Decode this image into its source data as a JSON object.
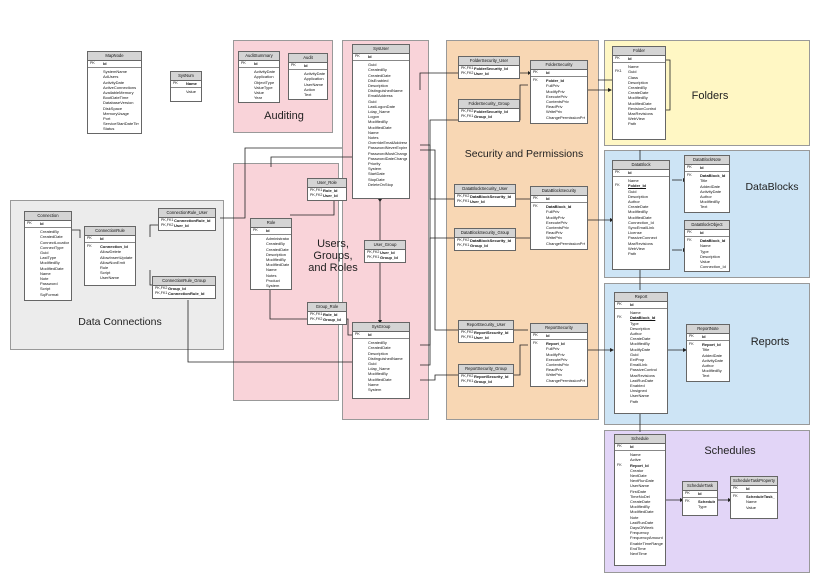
{
  "colors": {
    "auditing": "#f9d3d9",
    "users": "#f9d3d9",
    "security": "#f8d7b4",
    "folders": "#fff7c4",
    "datablocks": "#cde4f5",
    "reports": "#cde4f5",
    "schedules": "#e2d5f7",
    "connections": "#ececec"
  },
  "regions": {
    "auditing": "Auditing",
    "users": "Users,\nGroups,\nand Roles",
    "security": "Security and Permissions",
    "folders": "Folders",
    "datablocks": "DataBlocks",
    "reports": "Reports",
    "schedules": "Schedules",
    "connections": "Data Connections"
  },
  "tables": {
    "mapnode": {
      "name": "MapNode",
      "rows": [
        {
          "k": "PK",
          "f": "Id",
          "b": true
        },
        {
          "sep": true
        },
        {
          "f": "SystemName"
        },
        {
          "f": "AdUsers"
        },
        {
          "f": "ActivityDate"
        },
        {
          "f": "ActiveConnections"
        },
        {
          "f": "AvailableMemory"
        },
        {
          "f": "BootDateTime"
        },
        {
          "f": "DatabaseVersion"
        },
        {
          "f": "DiskSpace"
        },
        {
          "f": "MemoryUsage"
        },
        {
          "f": "Port"
        },
        {
          "f": "ServiceStartDateTime"
        },
        {
          "f": "Status"
        }
      ]
    },
    "sysnum": {
      "name": "SysNum",
      "rows": [
        {
          "k": "PK",
          "f": "Name",
          "b": true
        },
        {
          "sep": true
        },
        {
          "f": "Value"
        }
      ]
    },
    "auditsummary": {
      "name": "AuditSummary",
      "rows": [
        {
          "k": "PK",
          "f": "Id",
          "b": true
        },
        {
          "sep": true
        },
        {
          "f": "ActivityDate"
        },
        {
          "f": "Application"
        },
        {
          "f": "ObjectType"
        },
        {
          "f": "ValueType"
        },
        {
          "f": "Value"
        },
        {
          "f": "Year"
        }
      ]
    },
    "audit": {
      "name": "Audit",
      "rows": [
        {
          "k": "PK",
          "f": "Id",
          "b": true
        },
        {
          "sep": true
        },
        {
          "f": "ActivityDate"
        },
        {
          "f": "Application"
        },
        {
          "f": "UserName"
        },
        {
          "f": "Action"
        },
        {
          "f": "Text"
        }
      ]
    },
    "sysuser": {
      "name": "SysUser",
      "rows": [
        {
          "k": "PK",
          "f": "Id",
          "b": true
        },
        {
          "sep": true
        },
        {
          "f": "Guid"
        },
        {
          "f": "CreatedBy"
        },
        {
          "f": "CreatedDate"
        },
        {
          "f": "DisEnabled"
        },
        {
          "f": "Description"
        },
        {
          "f": "DistinguishedName"
        },
        {
          "f": "EmailAddress"
        },
        {
          "f": "Guid"
        },
        {
          "f": "LastLogonDate"
        },
        {
          "f": "Ldap_Name"
        },
        {
          "f": "Logon"
        },
        {
          "f": "ModifiedBy"
        },
        {
          "f": "ModifiedDate"
        },
        {
          "f": "Name"
        },
        {
          "f": "Notes"
        },
        {
          "f": "OverrideEmailAddress"
        },
        {
          "f": "PasswordNeverExpire"
        },
        {
          "f": "PasswordMustChange"
        },
        {
          "f": "PasswordDateChanged"
        },
        {
          "f": "Priority"
        },
        {
          "f": "System"
        },
        {
          "f": "StartDate"
        },
        {
          "f": "StopDate"
        },
        {
          "f": "DeleteOnStop"
        }
      ]
    },
    "user_role": {
      "name": "User_Role",
      "rows": [
        {
          "k": "PK,FK1",
          "f": "Role_Id",
          "b": true
        },
        {
          "k": "PK,FK2",
          "f": "User_Id",
          "b": true
        }
      ]
    },
    "role": {
      "name": "Role",
      "rows": [
        {
          "k": "PK",
          "f": "Id",
          "b": true
        },
        {
          "sep": true
        },
        {
          "f": "Administrator"
        },
        {
          "f": "CreatedBy"
        },
        {
          "f": "CreatedDate"
        },
        {
          "f": "Description"
        },
        {
          "f": "ModifiedBy"
        },
        {
          "f": "ModifiedDate"
        },
        {
          "f": "Name"
        },
        {
          "f": "Notes"
        },
        {
          "f": "Product"
        },
        {
          "f": "System"
        }
      ]
    },
    "user_group": {
      "name": "User_Group",
      "rows": [
        {
          "k": "PK,FK2",
          "f": "User_Id",
          "b": true
        },
        {
          "k": "PK,FK1",
          "f": "Group_Id",
          "b": true
        }
      ]
    },
    "group_role": {
      "name": "Group_Role",
      "rows": [
        {
          "k": "PK,FK1",
          "f": "Role_Id",
          "b": true
        },
        {
          "k": "PK,FK2",
          "f": "Group_Id",
          "b": true
        }
      ]
    },
    "sysgroup": {
      "name": "SysGroup",
      "rows": [
        {
          "k": "PK",
          "f": "Id",
          "b": true
        },
        {
          "sep": true
        },
        {
          "f": "CreatedBy"
        },
        {
          "f": "CreatedDate"
        },
        {
          "f": "Description"
        },
        {
          "f": "DistinguishedName"
        },
        {
          "f": "Guid"
        },
        {
          "f": "Ldap_Name"
        },
        {
          "f": "ModifiedBy"
        },
        {
          "f": "ModifiedDate"
        },
        {
          "f": "Name"
        },
        {
          "f": "System"
        }
      ]
    },
    "connectionrule_user": {
      "name": "ConnectionRule_User",
      "rows": [
        {
          "k": "PK,FK1",
          "f": "ConnectionRule_Id",
          "b": true
        },
        {
          "k": "PK,FK2",
          "f": "User_Id",
          "b": true
        }
      ]
    },
    "connection": {
      "name": "Connection",
      "rows": [
        {
          "k": "PK",
          "f": "Id",
          "b": true
        },
        {
          "sep": true
        },
        {
          "f": "CreatedBy"
        },
        {
          "f": "CreatedDate"
        },
        {
          "f": "ConnectLocation"
        },
        {
          "f": "ConnectType"
        },
        {
          "f": "Guid"
        },
        {
          "f": "LastType"
        },
        {
          "f": "ModifiedBy"
        },
        {
          "f": "ModifiedDate"
        },
        {
          "f": "Name"
        },
        {
          "f": "Note"
        },
        {
          "f": "Password"
        },
        {
          "f": "Script"
        },
        {
          "f": "SqlFormat"
        }
      ]
    },
    "connectionrule": {
      "name": "ConnectionRule",
      "rows": [
        {
          "k": "PK",
          "f": "Id",
          "b": true
        },
        {
          "sep": true
        },
        {
          "k": "FK",
          "f": "Connection_Id",
          "b": true
        },
        {
          "f": "AllowDelete"
        },
        {
          "f": "AllowInsertUpdate"
        },
        {
          "f": "AllowNonEmit"
        },
        {
          "f": "Rule"
        },
        {
          "f": "Script"
        },
        {
          "f": "UserName"
        }
      ]
    },
    "connectionrule_group": {
      "name": "ConnectionRule_Group",
      "rows": [
        {
          "k": "PK,FK2",
          "f": "Group_Id",
          "b": true
        },
        {
          "k": "PK,FK1",
          "f": "ConnectionRule_Id",
          "b": true
        }
      ]
    },
    "foldersecurity_user": {
      "name": "FolderSecurity_User",
      "rows": [
        {
          "k": "PK,FK1",
          "f": "FolderSecurity_Id",
          "b": true
        },
        {
          "k": "PK,FK2",
          "f": "User_Id",
          "b": true
        }
      ]
    },
    "foldersecurity_group": {
      "name": "FolderSecurity_Group",
      "rows": [
        {
          "k": "PK,FK2",
          "f": "FolderSecurity_Id",
          "b": true
        },
        {
          "k": "PK,FK1",
          "f": "Group_Id",
          "b": true
        }
      ]
    },
    "foldersecurity": {
      "name": "FolderSecurity",
      "rows": [
        {
          "k": "PK",
          "f": "Id",
          "b": true
        },
        {
          "sep": true
        },
        {
          "k": "FK",
          "f": "Folder_Id",
          "b": true
        },
        {
          "f": "FullPriv"
        },
        {
          "f": "ModifyPriv"
        },
        {
          "f": "ExecutePriv"
        },
        {
          "f": "ContentsPriv"
        },
        {
          "f": "ReadPriv"
        },
        {
          "f": "WritePriv"
        },
        {
          "f": "ChangePermissionPriv"
        }
      ]
    },
    "folder": {
      "name": "Folder",
      "rows": [
        {
          "k": "PK",
          "f": "Id",
          "b": true
        },
        {
          "sep": true
        },
        {
          "f": "Name"
        },
        {
          "k": "FK1",
          "f": "Guid"
        },
        {
          "f": "Class"
        },
        {
          "f": "Description"
        },
        {
          "f": "CreatedBy"
        },
        {
          "f": "CreateDate"
        },
        {
          "f": "ModifiedBy"
        },
        {
          "f": "ModifiedDate"
        },
        {
          "f": "RevisionControl"
        },
        {
          "f": "MaxRevisions"
        },
        {
          "f": "WebView"
        },
        {
          "f": "Path"
        }
      ]
    },
    "datablocksecurity_user": {
      "name": "DataBlockSecurity_User",
      "rows": [
        {
          "k": "PK,FK2",
          "f": "DataBlockSecurity_Id",
          "b": true
        },
        {
          "k": "PK,FK1",
          "f": "User_Id",
          "b": true
        }
      ]
    },
    "datablocksecurity_group": {
      "name": "DataBlockSecurity_Group",
      "rows": [
        {
          "k": "PK,FK2",
          "f": "DataBlockSecurity_Id",
          "b": true
        },
        {
          "k": "PK,FK1",
          "f": "Group_Id",
          "b": true
        }
      ]
    },
    "datablocksecurity": {
      "name": "DataBlockSecurity",
      "rows": [
        {
          "k": "PK",
          "f": "Id",
          "b": true
        },
        {
          "sep": true
        },
        {
          "k": "FK",
          "f": "DataBlock_Id",
          "b": true
        },
        {
          "f": "FullPriv"
        },
        {
          "f": "ModifyPriv"
        },
        {
          "f": "ExecutePriv"
        },
        {
          "f": "ContentsPriv"
        },
        {
          "f": "ReadPriv"
        },
        {
          "f": "WritePriv"
        },
        {
          "f": "ChangePermissionPriv"
        }
      ]
    },
    "datablock": {
      "name": "DataBlock",
      "rows": [
        {
          "k": "PK",
          "f": "Id",
          "b": true
        },
        {
          "sep": true
        },
        {
          "f": "Name"
        },
        {
          "k": "FK",
          "f": "Folder_Id",
          "b": true
        },
        {
          "f": "Guid"
        },
        {
          "f": "Description"
        },
        {
          "f": "Author"
        },
        {
          "f": "CreateDate"
        },
        {
          "f": "ModifiedBy"
        },
        {
          "f": "ModifiedDate"
        },
        {
          "f": "Connection_Id"
        },
        {
          "f": "SyncEmailLink"
        },
        {
          "f": "License"
        },
        {
          "f": "PassiveConnect"
        },
        {
          "f": "MaxRevisions"
        },
        {
          "f": "WebView"
        },
        {
          "f": "Path"
        }
      ]
    },
    "datablocknote": {
      "name": "DataBlockNote",
      "rows": [
        {
          "k": "PK",
          "f": "Id",
          "b": true
        },
        {
          "sep": true
        },
        {
          "k": "FK",
          "f": "DataBlock_Id",
          "b": true
        },
        {
          "f": "Title"
        },
        {
          "f": "AddedDate"
        },
        {
          "f": "ActivityDate"
        },
        {
          "f": "Author"
        },
        {
          "f": "ModifiedBy"
        },
        {
          "f": "Text"
        }
      ]
    },
    "datablockobject": {
      "name": "DataBlockObject",
      "rows": [
        {
          "k": "PK",
          "f": "Id",
          "b": true
        },
        {
          "sep": true
        },
        {
          "k": "FK",
          "f": "DataBlock_Id",
          "b": true
        },
        {
          "f": "Name"
        },
        {
          "f": "Type"
        },
        {
          "f": "Description"
        },
        {
          "f": "Value"
        },
        {
          "f": "Connection_Id"
        }
      ]
    },
    "reportsecurity_user": {
      "name": "ReportSecurity_User",
      "rows": [
        {
          "k": "PK,FK2",
          "f": "ReportSecurity_Id",
          "b": true
        },
        {
          "k": "PK,FK1",
          "f": "User_Id",
          "b": true
        }
      ]
    },
    "reportsecurity_group": {
      "name": "ReportSecurity_Group",
      "rows": [
        {
          "k": "PK,FK2",
          "f": "ReportSecurity_Id",
          "b": true
        },
        {
          "k": "PK,FK1",
          "f": "Group_Id",
          "b": true
        }
      ]
    },
    "reportsecurity": {
      "name": "ReportSecurity",
      "rows": [
        {
          "k": "PK",
          "f": "Id",
          "b": true
        },
        {
          "sep": true
        },
        {
          "k": "FK",
          "f": "Report_Id",
          "b": true
        },
        {
          "f": "FullPriv"
        },
        {
          "f": "ModifyPriv"
        },
        {
          "f": "ExecutePriv"
        },
        {
          "f": "ContentsPriv"
        },
        {
          "f": "ReadPriv"
        },
        {
          "f": "WritePriv"
        },
        {
          "f": "ChangePermissionPriv"
        }
      ]
    },
    "report": {
      "name": "Report",
      "rows": [
        {
          "k": "PK",
          "f": "Id",
          "b": true
        },
        {
          "sep": true
        },
        {
          "f": "Name"
        },
        {
          "k": "FK",
          "f": "DataBlock_Id",
          "b": true
        },
        {
          "f": "Type"
        },
        {
          "f": "Description"
        },
        {
          "f": "Author"
        },
        {
          "f": "CreateDate"
        },
        {
          "f": "ModifiedBy"
        },
        {
          "f": "ModifyDate"
        },
        {
          "f": "Guid"
        },
        {
          "f": "ExtProp"
        },
        {
          "f": "EmailLink"
        },
        {
          "f": "PassiveControl"
        },
        {
          "f": "MaxRevisions"
        },
        {
          "f": "LastRunDate"
        },
        {
          "f": "Enabled"
        },
        {
          "f": "Unsigned"
        },
        {
          "f": "UserName"
        },
        {
          "f": "Path"
        }
      ]
    },
    "reportnote": {
      "name": "ReportNote",
      "rows": [
        {
          "k": "PK",
          "f": "Id",
          "b": true
        },
        {
          "sep": true
        },
        {
          "k": "FK",
          "f": "Report_Id",
          "b": true
        },
        {
          "f": "Title"
        },
        {
          "f": "AddedDate"
        },
        {
          "f": "ActivityDate"
        },
        {
          "f": "Author"
        },
        {
          "f": "ModifiedBy"
        },
        {
          "f": "Text"
        }
      ]
    },
    "schedule": {
      "name": "Schedule",
      "rows": [
        {
          "k": "PK",
          "f": "Id",
          "b": true
        },
        {
          "sep": true
        },
        {
          "f": "Name"
        },
        {
          "f": "Active"
        },
        {
          "k": "FK",
          "f": "Report_Id",
          "b": true
        },
        {
          "f": "Creator"
        },
        {
          "f": "NextDate"
        },
        {
          "f": "NextRunDate"
        },
        {
          "f": "UserName"
        },
        {
          "f": "FirstDate"
        },
        {
          "f": "TimeNoDel"
        },
        {
          "f": "CreateDate"
        },
        {
          "f": "ModifiedBy"
        },
        {
          "f": "ModifiedDate"
        },
        {
          "f": "Note"
        },
        {
          "f": "LastRunDate"
        },
        {
          "f": "DaysOfWeek"
        },
        {
          "f": "Frequency"
        },
        {
          "f": "FrequencyAmount"
        },
        {
          "f": "EnableTimeRange"
        },
        {
          "f": "EndTime"
        },
        {
          "f": "NextTime"
        }
      ]
    },
    "scheduletask": {
      "name": "ScheduleTask",
      "rows": [
        {
          "k": "PK",
          "f": "Id",
          "b": true
        },
        {
          "sep": true
        },
        {
          "k": "FK",
          "f": "Schedule_Id",
          "b": true
        },
        {
          "f": "Type"
        }
      ]
    },
    "scheduletaskproperty": {
      "name": "ScheduleTaskProperty",
      "rows": [
        {
          "k": "PK",
          "f": "Id",
          "b": true
        },
        {
          "sep": true
        },
        {
          "k": "FK",
          "f": "ScheduleTask_Id",
          "b": true
        },
        {
          "f": "Name"
        },
        {
          "f": "Value"
        }
      ]
    }
  }
}
